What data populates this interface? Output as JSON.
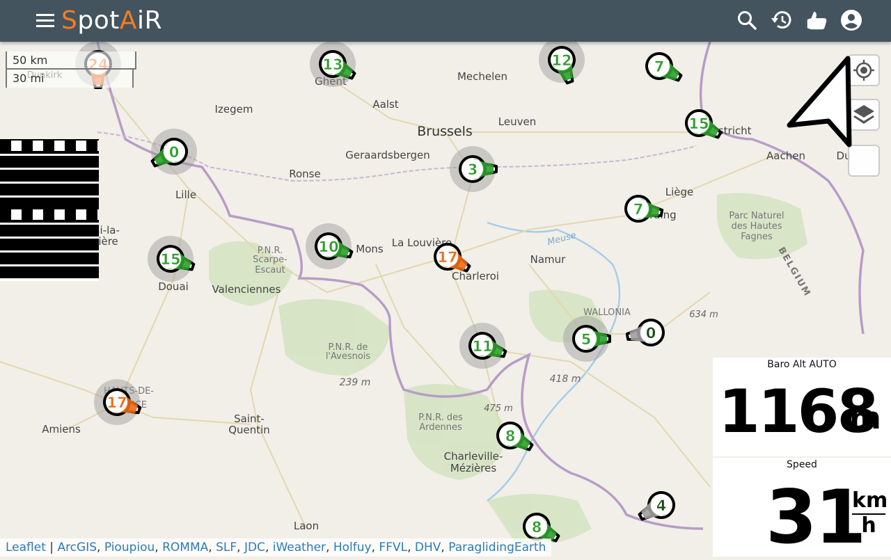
{
  "app": {
    "brand_s": "S",
    "brand_pot": "pot",
    "brand_a": "A",
    "brand_ir": "iR"
  },
  "colors": {
    "topbar": "#44545f",
    "accent": "#f57c1f",
    "green": "#2e9e2b",
    "orange": "#f06a13",
    "gray": "#9e9e9e"
  },
  "topbar": {
    "icons": [
      "menu-icon",
      "search-icon",
      "history-icon",
      "thumbs-icon",
      "account-icon"
    ]
  },
  "scale": {
    "km": "50 km",
    "mi": "30 mi"
  },
  "map": {
    "places": [
      {
        "name": "Dunkirk"
      },
      {
        "name": "Ghent"
      },
      {
        "name": "Mechelen"
      },
      {
        "name": "Izegem"
      },
      {
        "name": "Aalst"
      },
      {
        "name": "Brussels"
      },
      {
        "name": "Leuven"
      },
      {
        "name": "Maastricht"
      },
      {
        "name": "Geraardsbergen"
      },
      {
        "name": "Aachen"
      },
      {
        "name": "Du"
      },
      {
        "name": "Ronse"
      },
      {
        "name": "Lille"
      },
      {
        "name": "Liège"
      },
      {
        "name": "Seraing"
      },
      {
        "name": "Parc Naturel"
      },
      {
        "name": "des Hautes"
      },
      {
        "name": "Fagnes"
      },
      {
        "name": "Douai-la-"
      },
      {
        "name": "Bassière"
      },
      {
        "name": "P.N.R."
      },
      {
        "name": "Scarpe-"
      },
      {
        "name": "Escaut"
      },
      {
        "name": "Mons"
      },
      {
        "name": "La Louvière"
      },
      {
        "name": "Namur"
      },
      {
        "name": "Meuse"
      },
      {
        "name": "BELGIUM"
      },
      {
        "name": "Charleroi"
      },
      {
        "name": "Douai"
      },
      {
        "name": "Valenciennes"
      },
      {
        "name": "WALLONIA"
      },
      {
        "name": "634 m"
      },
      {
        "name": "P.N.R. de"
      },
      {
        "name": "l'Avesnois"
      },
      {
        "name": "239 m"
      },
      {
        "name": "418 m"
      },
      {
        "name": "HAUTS-DE-"
      },
      {
        "name": "FRANCE"
      },
      {
        "name": "475 m"
      },
      {
        "name": "Saint-"
      },
      {
        "name": "Quentin"
      },
      {
        "name": "P.N.R. des"
      },
      {
        "name": "Ardennes"
      },
      {
        "name": "Amiens"
      },
      {
        "name": "Charleville-"
      },
      {
        "name": "Mézières"
      },
      {
        "name": "Laon"
      }
    ],
    "markers": [
      {
        "value": "24",
        "status": "orange"
      },
      {
        "value": "13",
        "status": "green"
      },
      {
        "value": "12",
        "status": "green"
      },
      {
        "value": "7",
        "status": "green"
      },
      {
        "value": "15",
        "status": "green"
      },
      {
        "value": "0",
        "status": "green"
      },
      {
        "value": "3",
        "status": "green"
      },
      {
        "value": "7",
        "status": "green"
      },
      {
        "value": "15",
        "status": "green"
      },
      {
        "value": "10",
        "status": "green"
      },
      {
        "value": "17",
        "status": "orange"
      },
      {
        "value": "11",
        "status": "green"
      },
      {
        "value": "5",
        "status": "green"
      },
      {
        "value": "0",
        "status": "gray"
      },
      {
        "value": "17",
        "status": "orange"
      },
      {
        "value": "8",
        "status": "green"
      },
      {
        "value": "4",
        "status": "gray"
      },
      {
        "value": "8",
        "status": "green"
      }
    ]
  },
  "controls": {
    "icons": [
      "locate-icon",
      "layers-icon",
      "blank-control"
    ]
  },
  "widgets": {
    "altitude": {
      "label": "Baro Alt AUTO",
      "value": "1168",
      "unit": "m"
    },
    "speed": {
      "label": "Speed",
      "value": "31",
      "unit_top": "km",
      "unit_bottom": "h"
    }
  },
  "attribution": {
    "leaflet": "Leaflet",
    "sep": " | ",
    "sources": [
      "ArcGIS",
      "Pioupiou",
      "ROMMA",
      "SLF",
      "JDC",
      "iWeather",
      "Holfuy",
      "FFVL",
      "DHV",
      "ParaglidingEarth"
    ]
  }
}
